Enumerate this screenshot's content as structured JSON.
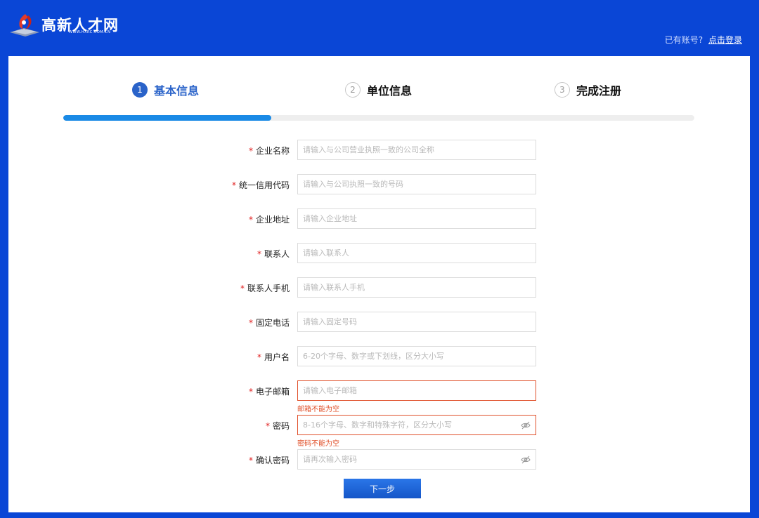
{
  "header": {
    "logo_text": "高新人才网",
    "logo_sub": "WWW.HXRC.COM.CN",
    "login_prompt": "已有账号?",
    "login_link": "点击登录"
  },
  "steps": [
    {
      "number": "1",
      "label": "基本信息",
      "active": true
    },
    {
      "number": "2",
      "label": "单位信息",
      "active": false
    },
    {
      "number": "3",
      "label": "完成注册",
      "active": false
    }
  ],
  "progress": {
    "percent": 33
  },
  "form": {
    "required_mark": "*",
    "fields": [
      {
        "label": "企业名称",
        "placeholder": "请输入与公司营业执照一致的公司全称",
        "value": ""
      },
      {
        "label": "统一信用代码",
        "placeholder": "请输入与公司执照一致的号码",
        "value": ""
      },
      {
        "label": "企业地址",
        "placeholder": "请输入企业地址",
        "value": ""
      },
      {
        "label": "联系人",
        "placeholder": "请输入联系人",
        "value": ""
      },
      {
        "label": "联系人手机",
        "placeholder": "请输入联系人手机",
        "value": ""
      },
      {
        "label": "固定电话",
        "placeholder": "请输入固定号码",
        "value": ""
      },
      {
        "label": "用户名",
        "placeholder": "6-20个字母、数字或下划线，区分大小写",
        "value": ""
      },
      {
        "label": "电子邮箱",
        "placeholder": "请输入电子邮箱",
        "value": "",
        "error": "邮箱不能为空"
      },
      {
        "label": "密码",
        "placeholder": "8-16个字母、数字和特殊字符，区分大小写",
        "value": "",
        "error": "密码不能为空"
      },
      {
        "label": "确认密码",
        "placeholder": "请再次输入密码",
        "value": ""
      }
    ],
    "next_button": "下一步"
  },
  "colors": {
    "background": "#0a46d6",
    "accent": "#2a63c9",
    "progress": "#1a8ae6",
    "error": "#e0502a",
    "required": "#e02020"
  }
}
